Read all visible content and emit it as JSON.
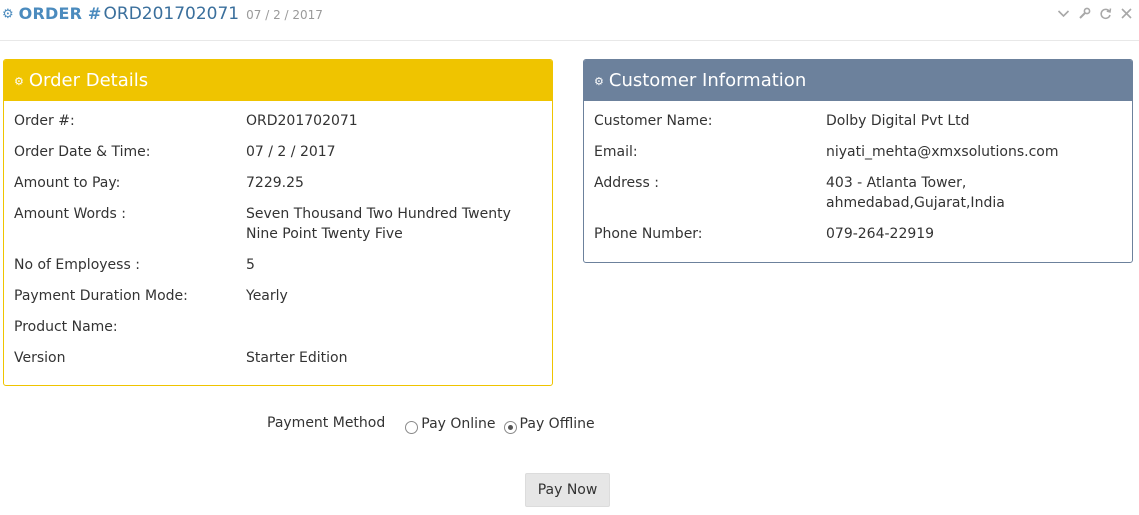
{
  "header": {
    "title_prefix": "ORDER #",
    "order_id": "ORD201702071",
    "date": "07 / 2 / 2017",
    "title_icon": "cogs-icon",
    "tools": [
      "chevron-down-icon",
      "wrench-icon",
      "refresh-icon",
      "close-icon"
    ]
  },
  "order_details": {
    "title": "Order Details",
    "accent_color": "#efc400",
    "rows": [
      {
        "label": "Order #:",
        "value": "ORD201702071"
      },
      {
        "label": "Order Date & Time:",
        "value": "07 / 2 / 2017"
      },
      {
        "label": "Amount to Pay:",
        "value": "7229.25"
      },
      {
        "label": "Amount Words :",
        "value": "Seven Thousand Two Hundred Twenty Nine Point Twenty Five"
      },
      {
        "label": "No of Employess :",
        "value": "5"
      },
      {
        "label": "Payment Duration Mode:",
        "value": "Yearly"
      },
      {
        "label": "Product Name:",
        "value": ""
      },
      {
        "label": "Version",
        "value": "Starter Edition"
      }
    ]
  },
  "customer_info": {
    "title": "Customer Information",
    "accent_color": "#6c819c",
    "rows": [
      {
        "label": "Customer Name:",
        "value": "Dolby Digital Pvt Ltd"
      },
      {
        "label": "Email:",
        "value": "niyati_mehta@xmxsolutions.com"
      },
      {
        "label": "Address :",
        "value": "403 - Atlanta Tower, ahmedabad,Gujarat,India"
      },
      {
        "label": "Phone Number:",
        "value": "079-264-22919"
      }
    ]
  },
  "payment": {
    "label": "Payment Method",
    "options": [
      {
        "label": "Pay Online",
        "selected": false
      },
      {
        "label": "Pay Offline",
        "selected": true
      }
    ],
    "button_label": "Pay Now"
  }
}
